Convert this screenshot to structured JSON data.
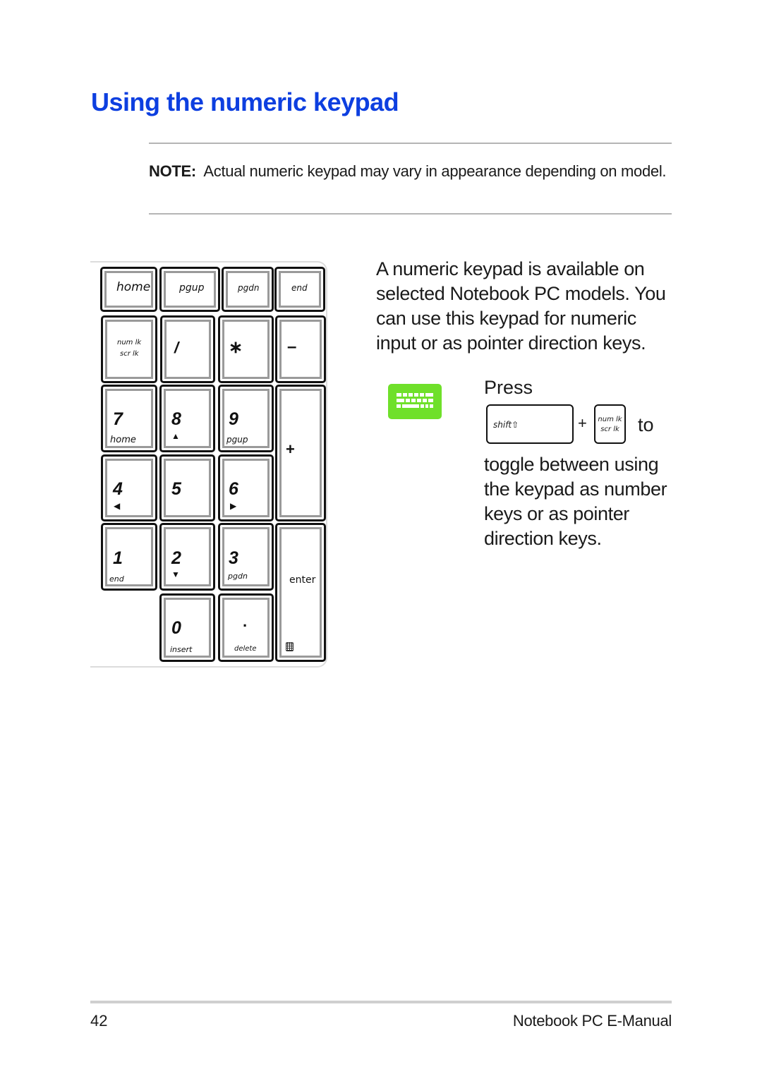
{
  "page": {
    "title": "Using the numeric keypad",
    "note_label": "NOTE:",
    "note_text": "Actual numeric keypad may vary in appearance depending on model.",
    "description": "A numeric keypad is available on selected Notebook PC models. You can use this keypad for numeric input or as pointer direction keys.",
    "press_label": "Press",
    "combo": {
      "key1": "shift⇧",
      "plus": "+",
      "key2_line1": "num lk",
      "key2_line2": "scr lk",
      "to": "to"
    },
    "toggle_text": "toggle between using the keypad as number keys or as pointer direction keys.",
    "keyboard_icon": "keyboard-icon",
    "keyboard_icon_color": "#6fe02a",
    "title_color": "#0d3fe0"
  },
  "keypad": {
    "top_row": [
      "home",
      "pgup",
      "pgdn",
      "end"
    ],
    "numlk": [
      "num lk",
      "scr lk"
    ],
    "slash": "/",
    "star": "∗",
    "minus": "–",
    "plus": "+",
    "enter": "enter",
    "keys": {
      "k7": {
        "num": "7",
        "sub": "home"
      },
      "k8": {
        "num": "8",
        "sub": "▲"
      },
      "k9": {
        "num": "9",
        "sub": "pgup"
      },
      "k4": {
        "num": "4",
        "sub": "◀"
      },
      "k5": {
        "num": "5",
        "sub": ""
      },
      "k6": {
        "num": "6",
        "sub": "▶"
      },
      "k1": {
        "num": "1",
        "sub": "end"
      },
      "k2": {
        "num": "2",
        "sub": "▼"
      },
      "k3": {
        "num": "3",
        "sub": "pgdn"
      },
      "k0": {
        "num": "0",
        "sub": "insert"
      },
      "kdot": {
        "num": "·",
        "sub": "delete"
      }
    }
  },
  "footer": {
    "page_number": "42",
    "doc_title": "Notebook PC E-Manual"
  }
}
